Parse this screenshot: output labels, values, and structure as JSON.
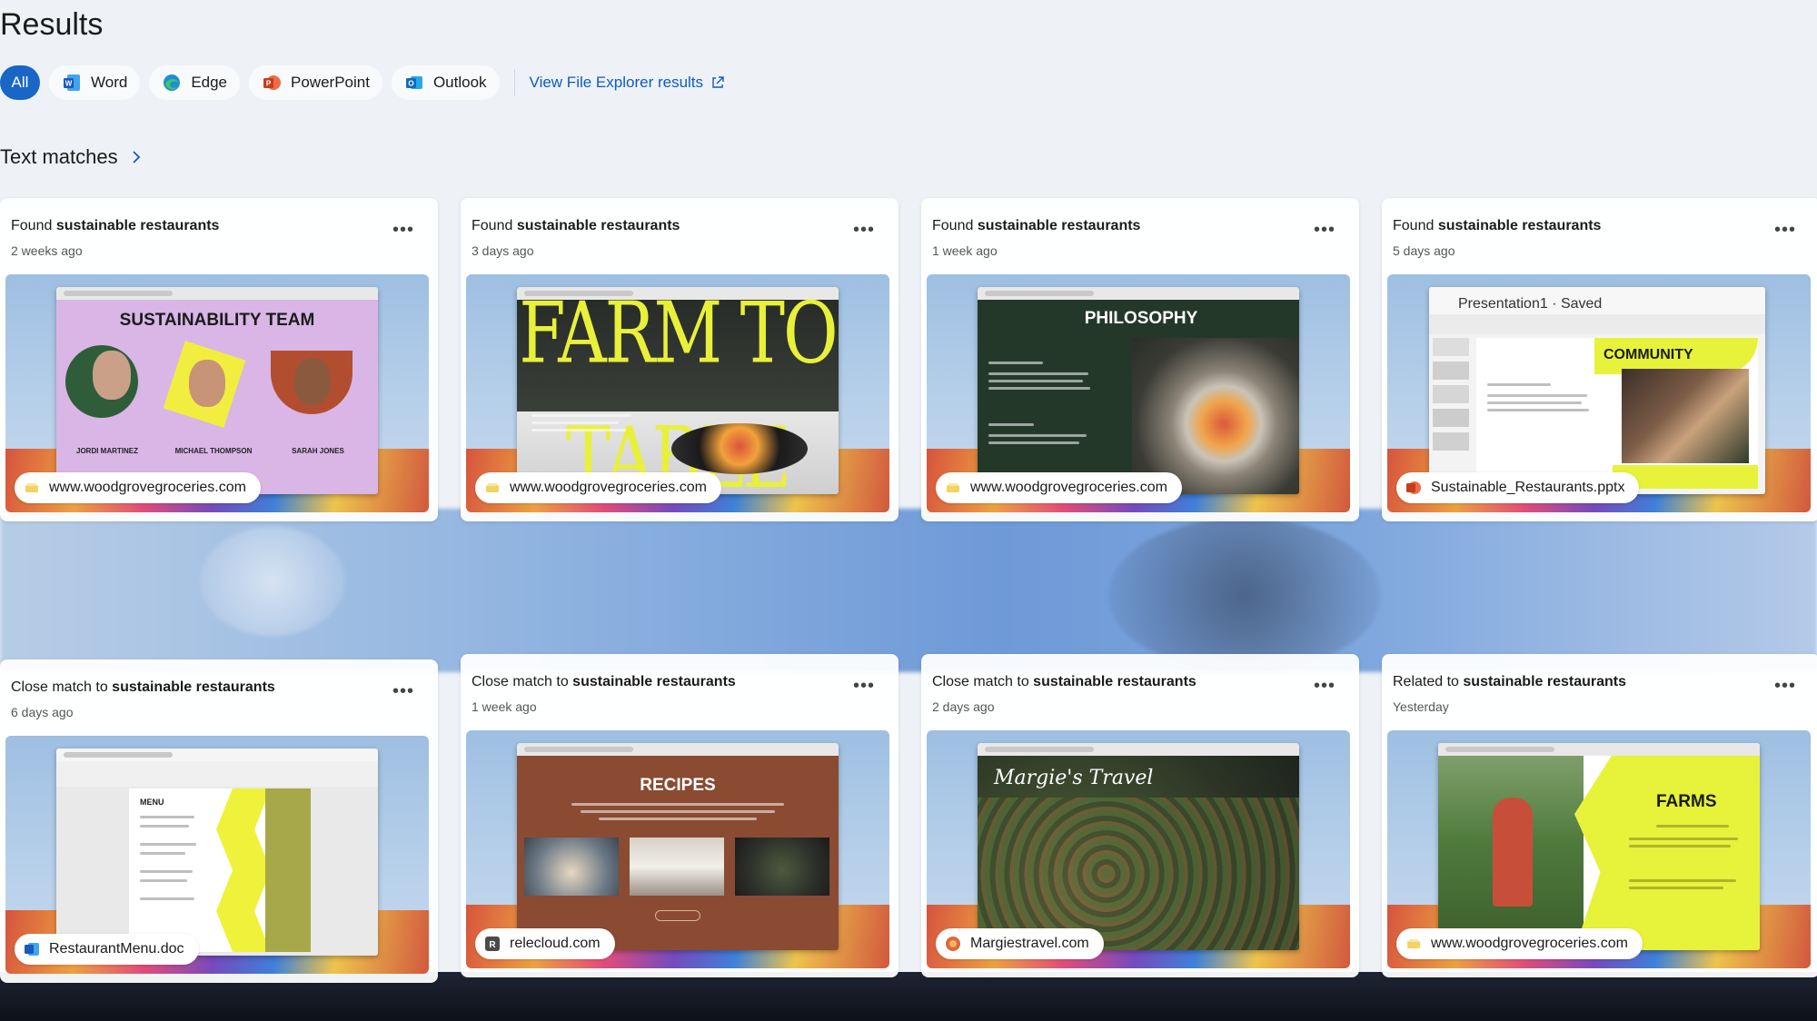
{
  "header": {
    "title": "Results"
  },
  "filters": {
    "all": "All",
    "chips": [
      {
        "label": "Word",
        "icon": "word-icon",
        "color": "#185abd"
      },
      {
        "label": "Edge",
        "icon": "edge-icon",
        "color": "#1e8fd6"
      },
      {
        "label": "PowerPoint",
        "icon": "powerpoint-icon",
        "color": "#c43e1c"
      },
      {
        "label": "Outlook",
        "icon": "outlook-icon",
        "color": "#0f6cbd"
      }
    ],
    "explorer_link": "View File Explorer results"
  },
  "section": {
    "title": "Text matches"
  },
  "cards": [
    {
      "prefix": "Found",
      "query": "sustainable restaurants",
      "time": "2 weeks ago",
      "source": "www.woodgrovegroceries.com",
      "source_icon": "browser-favicon-icon",
      "slide_title": "SUSTAINABILITY TEAM",
      "people": [
        "JORDI MARTINEZ",
        "MICHAEL THOMPSON",
        "SARAH JONES"
      ]
    },
    {
      "prefix": "Found",
      "query": "sustainable restaurants",
      "time": "3 days ago",
      "source": "www.woodgrovegroceries.com",
      "source_icon": "browser-favicon-icon",
      "slide_title": "FARM TO TABLE"
    },
    {
      "prefix": "Found",
      "query": "sustainable restaurants",
      "time": "1 week ago",
      "source": "www.woodgrovegroceries.com",
      "source_icon": "browser-favicon-icon",
      "slide_title": "PHILOSOPHY"
    },
    {
      "prefix": "Found",
      "query": "sustainable restaurants",
      "time": "5 days ago",
      "source": "Sustainable_Restaurants.pptx",
      "source_icon": "powerpoint-icon",
      "slide_title": "COMMUNITY",
      "window_title": "Presentation1 · Saved"
    },
    {
      "prefix": "Close match to",
      "query": "sustainable restaurants",
      "time": "6 days ago",
      "source": "RestaurantMenu.doc",
      "source_icon": "word-icon",
      "slide_title": "MENU"
    },
    {
      "prefix": "Close match to",
      "query": "sustainable restaurants",
      "time": "1 week ago",
      "source": "relecloud.com",
      "source_icon": "relecloud-icon",
      "slide_title": "RECIPES"
    },
    {
      "prefix": "Close match to",
      "query": "sustainable restaurants",
      "time": "2 days ago",
      "source": "Margiestravel.com",
      "source_icon": "margies-icon",
      "slide_title": "Margie's Travel"
    },
    {
      "prefix": "Related to",
      "query": "sustainable restaurants",
      "time": "Yesterday",
      "source": "www.woodgrovegroceries.com",
      "source_icon": "browser-favicon-icon",
      "slide_title": "FARMS"
    }
  ]
}
